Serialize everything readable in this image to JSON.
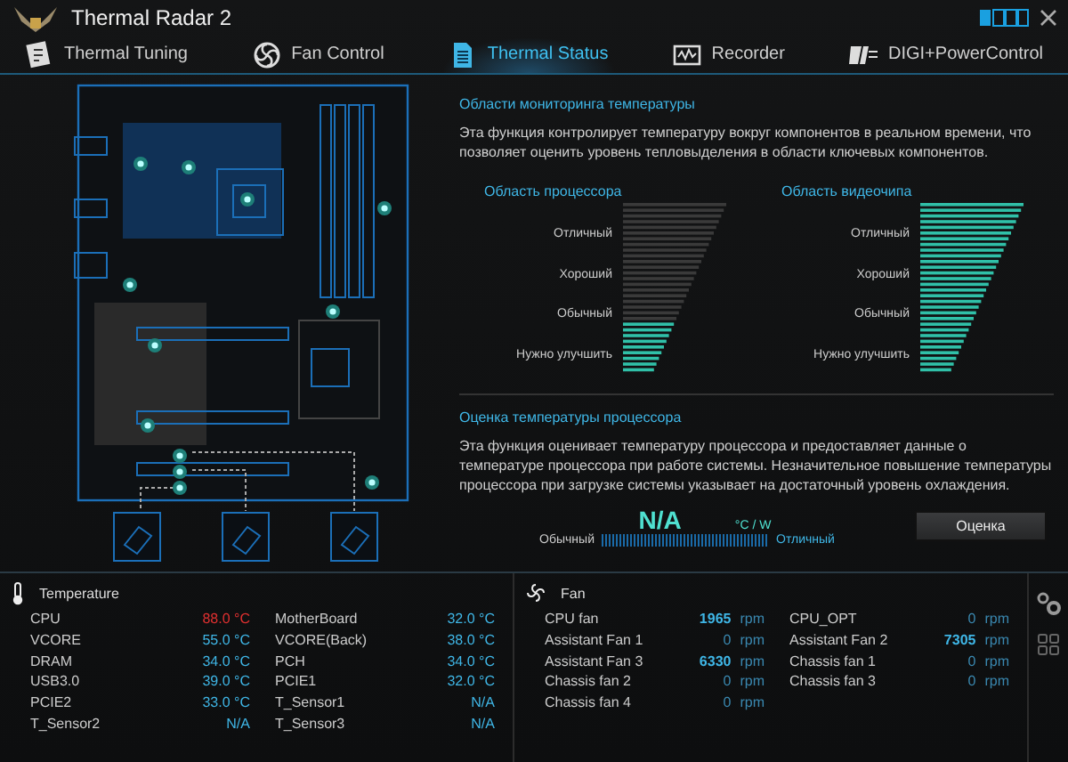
{
  "window": {
    "title": "Thermal Radar 2"
  },
  "tabs": [
    {
      "label": "Thermal Tuning",
      "kind": "tuning",
      "selected": false
    },
    {
      "label": "Fan Control",
      "kind": "fan",
      "selected": false
    },
    {
      "label": "Thermal Status",
      "kind": "status",
      "selected": true
    },
    {
      "label": "Recorder",
      "kind": "recorder",
      "selected": false
    },
    {
      "label": "DIGI+PowerControl",
      "kind": "digi",
      "selected": false
    }
  ],
  "monitoring": {
    "title": "Области мониторинга температуры",
    "description": "Эта функция контролирует температуру вокруг компонентов в реальном времени, что позволяет оценить уровень тепловыделения в области ключевых компонентов.",
    "meters": [
      {
        "title": "Область процессора",
        "levels": [
          "Отличный",
          "Хороший",
          "Обычный",
          "Нужно улучшить"
        ],
        "level": 0.3
      },
      {
        "title": "Область видеочипа",
        "levels": [
          "Отличный",
          "Хороший",
          "Обычный",
          "Нужно улучшить"
        ],
        "level": 1
      }
    ]
  },
  "rating": {
    "title": "Оценка температуры процессора",
    "description": "Эта функция оценивает температуру процессора и предоставляет данные о температуре процессора при работе системы. Незначительное повышение температуры процессора при загрузке системы указывает на достаточный уровень охлаждения.",
    "value": "N/A",
    "unit": "°C / W",
    "low_label": "Обычный",
    "high_label": "Отличный",
    "button": "Оценка"
  },
  "temperature": {
    "title": "Temperature",
    "rows": [
      {
        "name": "CPU",
        "value": "88.0 °C",
        "warning": true
      },
      {
        "name": "MotherBoard",
        "value": "32.0 °C",
        "warning": false
      },
      {
        "name": "VCORE",
        "value": "55.0 °C",
        "warning": false
      },
      {
        "name": "VCORE(Back)",
        "value": "38.0 °C",
        "warning": false
      },
      {
        "name": "DRAM",
        "value": "34.0 °C",
        "warning": false
      },
      {
        "name": "PCH",
        "value": "34.0 °C",
        "warning": false
      },
      {
        "name": "USB3.0",
        "value": "39.0 °C",
        "warning": false
      },
      {
        "name": "PCIE1",
        "value": "32.0 °C",
        "warning": false
      },
      {
        "name": "PCIE2",
        "value": "33.0 °C",
        "warning": false
      },
      {
        "name": "T_Sensor1",
        "value": "N/A",
        "warning": false
      },
      {
        "name": "T_Sensor2",
        "value": "N/A",
        "warning": false
      },
      {
        "name": "T_Sensor3",
        "value": "N/A",
        "warning": false
      }
    ]
  },
  "fan": {
    "title": "Fan",
    "rows": [
      {
        "name": "CPU fan",
        "value": "1965",
        "unit": "rpm",
        "active": true
      },
      {
        "name": "CPU_OPT",
        "value": "0",
        "unit": "rpm",
        "active": false
      },
      {
        "name": "Assistant Fan 1",
        "value": "0",
        "unit": "rpm",
        "active": false
      },
      {
        "name": "Assistant Fan 2",
        "value": "7305",
        "unit": "rpm",
        "active": true
      },
      {
        "name": "Assistant Fan 3",
        "value": "6330",
        "unit": "rpm",
        "active": true
      },
      {
        "name": "Chassis fan 1",
        "value": "0",
        "unit": "rpm",
        "active": false
      },
      {
        "name": "Chassis fan 2",
        "value": "0",
        "unit": "rpm",
        "active": false
      },
      {
        "name": "Chassis fan 3",
        "value": "0",
        "unit": "rpm",
        "active": false
      },
      {
        "name": "Chassis fan 4",
        "value": "0",
        "unit": "rpm",
        "active": false
      }
    ]
  }
}
